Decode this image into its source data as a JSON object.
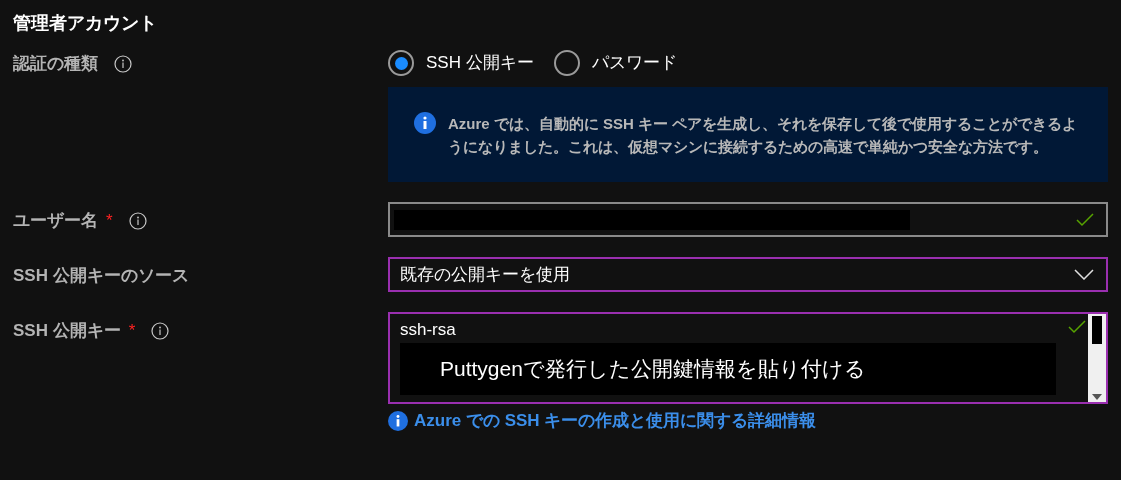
{
  "section_title": "管理者アカウント",
  "fields": [
    {
      "kind": "radio",
      "label": "認証の種類",
      "info": true,
      "options": [
        {
          "label": "SSH 公開キー",
          "selected": true
        },
        {
          "label": "パスワード",
          "selected": false
        }
      ],
      "notice": "Azure では、自動的に SSH キー ペアを生成し、それを保存して後で使用することができるようになりました。これは、仮想マシンに接続するための高速で単純かつ安全な方法です。"
    },
    {
      "kind": "text",
      "label": "ユーザー名",
      "required_mark": "*",
      "info": true,
      "valid": true,
      "focused": false
    },
    {
      "kind": "select",
      "label": "SSH 公開キーのソース",
      "info": false,
      "value": "既存の公開キーを使用",
      "focused": true
    },
    {
      "kind": "textarea",
      "label": "SSH 公開キー",
      "required_mark": "*",
      "info": true,
      "value": "ssh-rsa",
      "annotation": "Puttygenで発行した公開鍵情報を貼り付ける",
      "valid": true,
      "focused": true,
      "link": "Azure での SSH キーの作成と使用に関する詳細情報"
    }
  ]
}
